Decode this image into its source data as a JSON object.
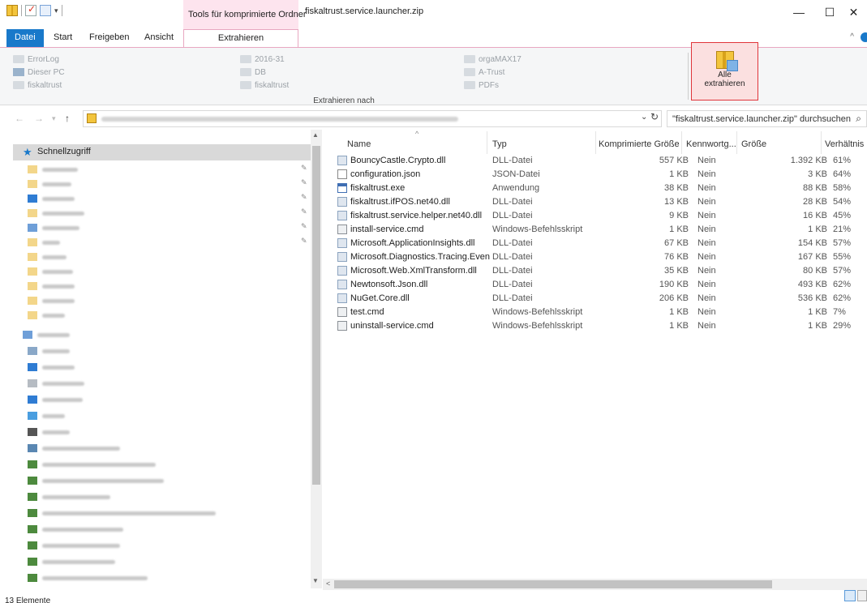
{
  "titlebar": {
    "context_tab_title": "Tools für komprimierte Ordner",
    "window_title": "fiskaltrust.service.launcher.zip",
    "minimize": "—",
    "maximize": "☐",
    "close": "✕"
  },
  "tabs": {
    "file": "Datei",
    "start": "Start",
    "share": "Freigeben",
    "view": "Ansicht",
    "extract": "Extrahieren"
  },
  "ribbon": {
    "destinations": [
      [
        "ErrorLog",
        "2016-31",
        "orgaMAX17"
      ],
      [
        "Dieser PC",
        "DB",
        "A-Trust"
      ],
      [
        "fiskaltrust",
        "fiskaltrust",
        "PDFs"
      ]
    ],
    "extract_all_label_1": "Alle",
    "extract_all_label_2": "extrahieren",
    "group_label": "Extrahieren nach"
  },
  "address": {
    "search_placeholder": "\"fiskaltrust.service.launcher.zip\" durchsuchen"
  },
  "nav": {
    "quick_access": "Schnellzugriff"
  },
  "columns": {
    "name": "Name",
    "type": "Typ",
    "compressed": "Komprimierte Größe",
    "password": "Kennwortg...",
    "size": "Größe",
    "ratio": "Verhältnis"
  },
  "files": [
    {
      "name": "BouncyCastle.Crypto.dll",
      "type": "DLL-Datei",
      "compressed": "557 KB",
      "password": "Nein",
      "size": "1.392 KB",
      "ratio": "61%",
      "icon": "dll"
    },
    {
      "name": "configuration.json",
      "type": "JSON-Datei",
      "compressed": "1 KB",
      "password": "Nein",
      "size": "3 KB",
      "ratio": "64%",
      "icon": "json"
    },
    {
      "name": "fiskaltrust.exe",
      "type": "Anwendung",
      "compressed": "38 KB",
      "password": "Nein",
      "size": "88 KB",
      "ratio": "58%",
      "icon": "exe"
    },
    {
      "name": "fiskaltrust.ifPOS.net40.dll",
      "type": "DLL-Datei",
      "compressed": "13 KB",
      "password": "Nein",
      "size": "28 KB",
      "ratio": "54%",
      "icon": "dll"
    },
    {
      "name": "fiskaltrust.service.helper.net40.dll",
      "type": "DLL-Datei",
      "compressed": "9 KB",
      "password": "Nein",
      "size": "16 KB",
      "ratio": "45%",
      "icon": "dll"
    },
    {
      "name": "install-service.cmd",
      "type": "Windows-Befehlsskript",
      "compressed": "1 KB",
      "password": "Nein",
      "size": "1 KB",
      "ratio": "21%",
      "icon": "cmd"
    },
    {
      "name": "Microsoft.ApplicationInsights.dll",
      "type": "DLL-Datei",
      "compressed": "67 KB",
      "password": "Nein",
      "size": "154 KB",
      "ratio": "57%",
      "icon": "dll"
    },
    {
      "name": "Microsoft.Diagnostics.Tracing.Even...",
      "type": "DLL-Datei",
      "compressed": "76 KB",
      "password": "Nein",
      "size": "167 KB",
      "ratio": "55%",
      "icon": "dll"
    },
    {
      "name": "Microsoft.Web.XmlTransform.dll",
      "type": "DLL-Datei",
      "compressed": "35 KB",
      "password": "Nein",
      "size": "80 KB",
      "ratio": "57%",
      "icon": "dll"
    },
    {
      "name": "Newtonsoft.Json.dll",
      "type": "DLL-Datei",
      "compressed": "190 KB",
      "password": "Nein",
      "size": "493 KB",
      "ratio": "62%",
      "icon": "dll"
    },
    {
      "name": "NuGet.Core.dll",
      "type": "DLL-Datei",
      "compressed": "206 KB",
      "password": "Nein",
      "size": "536 KB",
      "ratio": "62%",
      "icon": "dll"
    },
    {
      "name": "test.cmd",
      "type": "Windows-Befehlsskript",
      "compressed": "1 KB",
      "password": "Nein",
      "size": "1 KB",
      "ratio": "7%",
      "icon": "cmd"
    },
    {
      "name": "uninstall-service.cmd",
      "type": "Windows-Befehlsskript",
      "compressed": "1 KB",
      "password": "Nein",
      "size": "1 KB",
      "ratio": "29%",
      "icon": "cmd"
    }
  ],
  "status": {
    "item_count": "13 Elemente"
  }
}
